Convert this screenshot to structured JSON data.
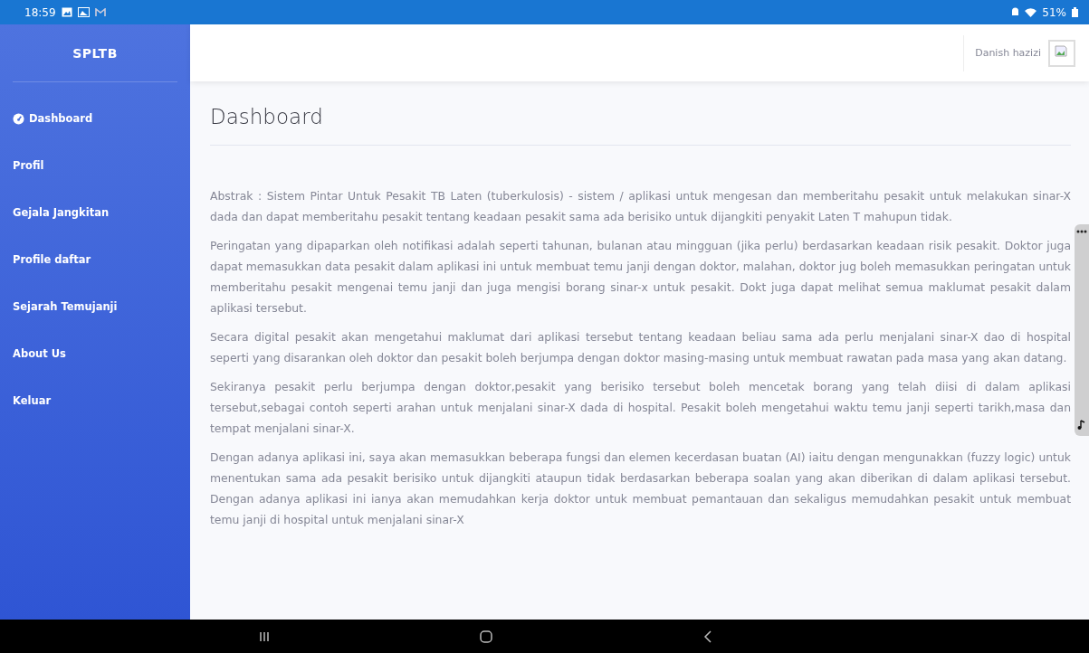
{
  "status_bar": {
    "time": "18:59",
    "battery": "51%"
  },
  "sidebar": {
    "brand": "SPLTB",
    "items": [
      {
        "label": "Dashboard",
        "kind": "icon"
      },
      {
        "label": "Profil",
        "kind": "plain"
      },
      {
        "label": "Gejala Jangkitan",
        "kind": "plain"
      },
      {
        "label": "Profile daftar",
        "kind": "plain"
      },
      {
        "label": "Sejarah Temujanji",
        "kind": "plain"
      },
      {
        "label": "About Us",
        "kind": "plain"
      },
      {
        "label": "Keluar",
        "kind": "plain"
      }
    ]
  },
  "topbar": {
    "user_name": "Danish hazizi"
  },
  "page": {
    "title": "Dashboard",
    "paragraphs": [
      "Abstrak : Sistem Pintar Untuk Pesakit TB Laten (tuberkulosis) - sistem / aplikasi untuk mengesan dan memberitahu pesakit untuk melakukan sinar-X dada dan dapat memberitahu pesakit tentang keadaan pesakit sama ada berisiko untuk dijangkiti penyakit Laten T mahupun tidak.",
      "Peringatan yang dipaparkan oleh notifikasi adalah seperti tahunan, bulanan atau mingguan (jika perlu) berdasarkan keadaan risik pesakit. Doktor juga dapat memasukkan data pesakit dalam aplikasi ini untuk membuat temu janji dengan doktor, malahan, doktor jug boleh memasukkan peringatan untuk memberitahu pesakit mengenai temu janji dan juga mengisi borang sinar-x untuk pesakit. Dokt juga dapat melihat semua maklumat pesakit dalam aplikasi tersebut.",
      "Secara digital pesakit akan mengetahui maklumat dari aplikasi tersebut tentang keadaan beliau sama ada perlu menjalani sinar-X dao di hospital seperti yang disarankan oleh doktor dan pesakit boleh berjumpa dengan doktor masing-masing untuk membuat rawatan pada masa yang akan datang.",
      "Sekiranya pesakit perlu berjumpa dengan doktor,pesakit yang berisiko tersebut boleh mencetak borang yang telah diisi di dalam aplikasi tersebut,sebagai contoh seperti arahan untuk menjalani sinar-X dada di hospital. Pesakit boleh mengetahui waktu temu janji seperti tarikh,masa dan tempat menjalani sinar-X.",
      "Dengan adanya aplikasi ini, saya akan memasukkan beberapa fungsi dan elemen kecerdasan buatan (AI) iaitu dengan mengunakkan (fuzzy logic) untuk menentukan sama ada pesakit berisiko untuk dijangkiti ataupun tidak berdasarkan beberapa soalan yang akan diberikan di dalam aplikasi tersebut. Dengan adanya aplikasi ini ianya akan memudahkan kerja doktor untuk membuat pemantauan dan sekaligus memudahkan pesakit untuk membuat temu janji di hospital untuk menjalani sinar-X"
    ]
  }
}
